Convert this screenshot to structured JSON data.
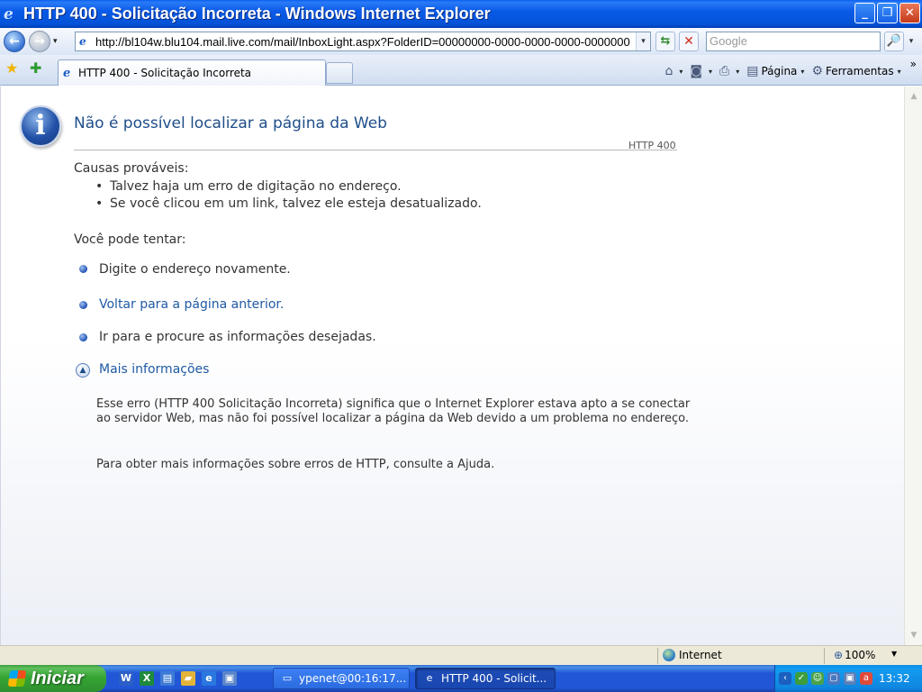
{
  "window": {
    "title": "HTTP 400 - Solicitação Incorreta - Windows Internet Explorer",
    "min_label": "_",
    "max_label": "❐",
    "close_label": "✕"
  },
  "toolbar": {
    "back_label": "←",
    "forward_label": "→",
    "nav_dropdown": "▾",
    "url": "http://bl104w.blu104.mail.live.com/mail/InboxLight.aspx?FolderID=00000000-0000-0000-0000-0000000",
    "refresh_label": "⇆",
    "stop_label": "✕",
    "search_placeholder": "Google",
    "search_btn_label": "🔎"
  },
  "tabs": {
    "active_tab_label": "HTTP 400 - Solicitação Incorreta"
  },
  "command_bar": {
    "home": "⌂",
    "feeds": "◙",
    "print": "⎙",
    "page_label": "Página",
    "tools_label": "Ferramentas",
    "more": "»"
  },
  "page": {
    "heading": "Não é possível localizar a página da Web",
    "code": "HTTP 400",
    "causes_title": "Causas prováveis:",
    "causes": [
      "Talvez haja um erro de digitação no endereço.",
      "Se você clicou em um link, talvez ele esteja desatualizado."
    ],
    "try_title": "Você pode tentar:",
    "try_retype": "Digite o endereço novamente.",
    "try_back": "Voltar para a página anterior.",
    "try_goto": "Ir para  e procure as informações desejadas.",
    "more_info": "Mais informações",
    "explain": "Esse erro (HTTP 400 Solicitação Incorreta) significa que o Internet Explorer estava apto a se conectar ao servidor Web, mas não foi possível localizar a página da Web devido a um problema no endereço.",
    "help": "Para obter mais informações sobre erros de HTTP, consulte a Ajuda."
  },
  "status": {
    "zone": "Internet",
    "zoom": "100%"
  },
  "taskbar": {
    "start_label": "Iniciar",
    "buttons": [
      {
        "label": "ypenet@00:16:17..."
      },
      {
        "label": "HTTP 400 - Solicit..."
      }
    ],
    "clock": "13:32"
  },
  "colors": {
    "heading": "#1f4e8a",
    "link": "#1f5aa3",
    "titlebar": "#0452d6",
    "start": "#35a534"
  }
}
